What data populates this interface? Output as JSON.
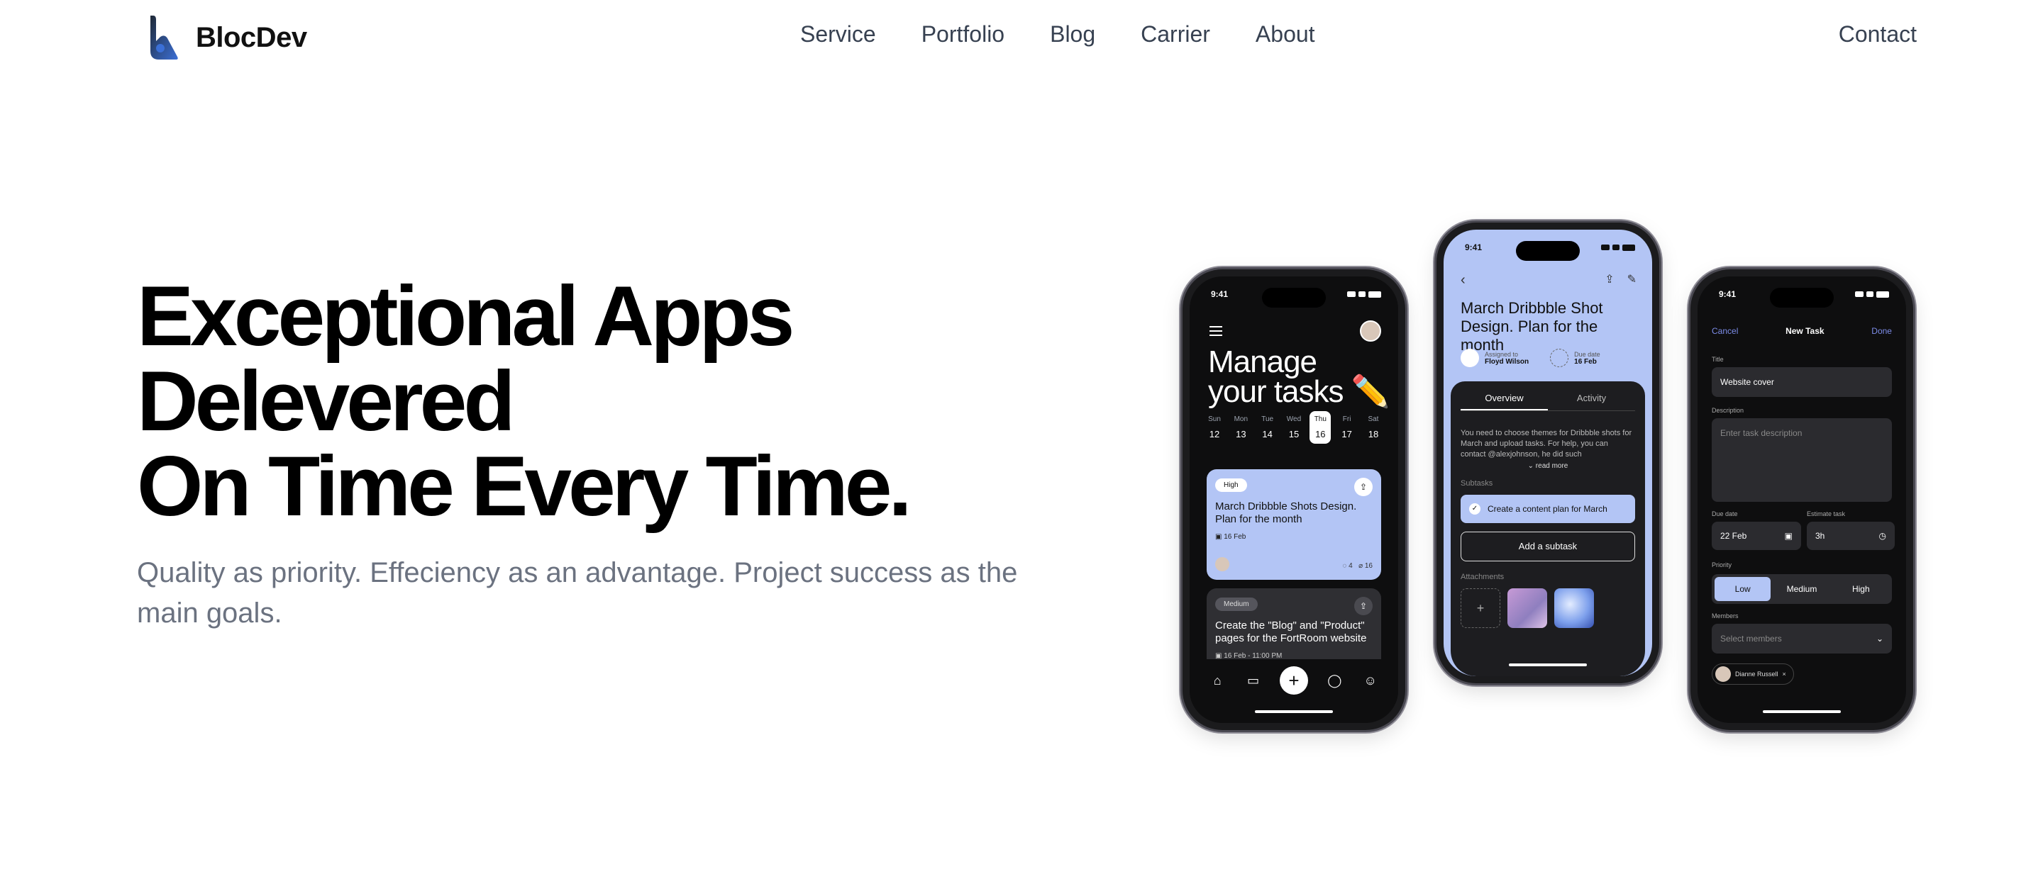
{
  "brand": {
    "name": "BlocDev",
    "accent": "#1e3a8a"
  },
  "nav": {
    "links": [
      "Service",
      "Portfolio",
      "Blog",
      "Carrier",
      "About"
    ],
    "contact": "Contact"
  },
  "hero": {
    "line1": "Exceptional Apps",
    "line2": "Delevered",
    "line3": "On Time Every Time.",
    "subtitle": "Quality as priority. Effeciency as an advantage. Project success as the main goals."
  },
  "phone1": {
    "time": "9:41",
    "heading_line1": "Manage",
    "heading_line2": "your tasks",
    "days": [
      {
        "name": "Sun",
        "num": "12"
      },
      {
        "name": "Mon",
        "num": "13"
      },
      {
        "name": "Tue",
        "num": "14"
      },
      {
        "name": "Wed",
        "num": "15"
      },
      {
        "name": "Thu",
        "num": "16"
      },
      {
        "name": "Fri",
        "num": "17"
      },
      {
        "name": "Sat",
        "num": "18"
      }
    ],
    "active_day": 4,
    "card1": {
      "tag": "High",
      "title": "March Dribbble Shots Design. Plan for the month",
      "date": "16 Feb",
      "comments": "4",
      "attachments": "16"
    },
    "card2": {
      "tag": "Medium",
      "title": "Create the \"Blog\" and \"Product\" pages for the FortRoom website",
      "date": "16 Feb - 11:00 PM"
    }
  },
  "phone2": {
    "time": "9:41",
    "title": "March Dribbble Shot Design. Plan for the month",
    "assigned_label": "Assigned to",
    "assigned_value": "Floyd Wilson",
    "due_label": "Due date",
    "due_value": "16 Feb",
    "tabs": [
      "Overview",
      "Activity"
    ],
    "description": "You need to choose themes for Dribbble shots for March and upload tasks. For help, you can contact @alexjohnson, he did such",
    "read_more": "read more",
    "subtasks_label": "Subtasks",
    "subtask": "Create a content plan for March",
    "add_subtask": "Add a subtask",
    "attachments_label": "Attachments"
  },
  "phone3": {
    "time": "9:41",
    "cancel": "Cancel",
    "title": "New Task",
    "done": "Done",
    "title_label": "Title",
    "title_value": "Website cover",
    "desc_label": "Description",
    "desc_placeholder": "Enter task description",
    "due_label": "Due date",
    "due_value": "22 Feb",
    "est_label": "Estimate task",
    "est_value": "3h",
    "priority_label": "Priority",
    "priorities": [
      "Low",
      "Medium",
      "High"
    ],
    "members_label": "Members",
    "members_placeholder": "Select members",
    "member_chip": "Dianne Russell"
  }
}
